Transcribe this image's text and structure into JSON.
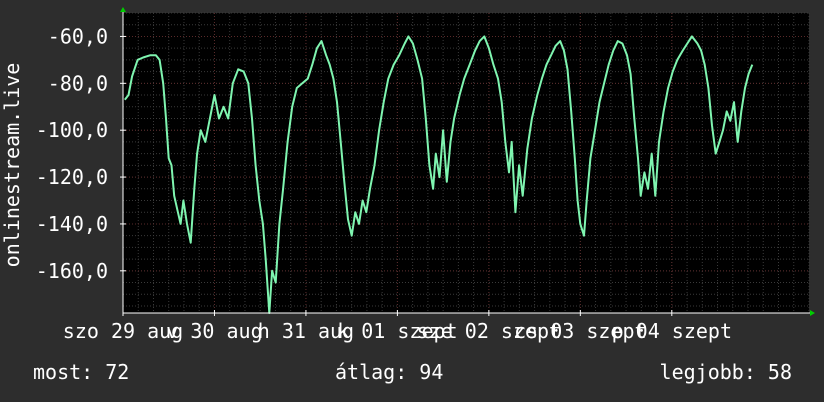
{
  "colors": {
    "background": "#2d2d2d",
    "plot_background": "#000000",
    "grid_minor": "#3a3a3a",
    "grid_major": "#5a2a2a",
    "line": "#7ff5b0",
    "axis_arrow": "#00cc00"
  },
  "chart_data": {
    "type": "line",
    "ylabel": "onlinestream.live",
    "ylim": [
      -178,
      -50
    ],
    "yticks": [
      -60,
      -80,
      -100,
      -120,
      -140,
      -160
    ],
    "ytick_labels": [
      "-60,0",
      "-80,0",
      "-100,0",
      "-120,0",
      "-140,0",
      "-160,0"
    ],
    "xlim": [
      0,
      7.5
    ],
    "xticks": [
      {
        "x": 0.0,
        "label": "szo 29 aug"
      },
      {
        "x": 1.0,
        "label": "v 30 aug"
      },
      {
        "x": 2.0,
        "label": "h 31 aug"
      },
      {
        "x": 3.0,
        "label": "k 01 szept"
      },
      {
        "x": 4.0,
        "label": "sze 02 szept"
      },
      {
        "x": 5.0,
        "label": "cs 03 szept"
      },
      {
        "x": 6.0,
        "label": "p 04 szept"
      }
    ],
    "grid": true,
    "series": [
      {
        "values": [
          [
            0.02,
            -87
          ],
          [
            0.06,
            -85
          ],
          [
            0.1,
            -77
          ],
          [
            0.16,
            -70
          ],
          [
            0.22,
            -69
          ],
          [
            0.3,
            -68
          ],
          [
            0.36,
            -68
          ],
          [
            0.4,
            -70
          ],
          [
            0.44,
            -80
          ],
          [
            0.47,
            -95
          ],
          [
            0.5,
            -112
          ],
          [
            0.53,
            -115
          ],
          [
            0.56,
            -128
          ],
          [
            0.6,
            -135
          ],
          [
            0.63,
            -140
          ],
          [
            0.66,
            -130
          ],
          [
            0.7,
            -140
          ],
          [
            0.74,
            -148
          ],
          [
            0.78,
            -125
          ],
          [
            0.81,
            -110
          ],
          [
            0.85,
            -100
          ],
          [
            0.9,
            -105
          ],
          [
            0.95,
            -95
          ],
          [
            1.0,
            -85
          ],
          [
            1.05,
            -95
          ],
          [
            1.1,
            -90
          ],
          [
            1.15,
            -95
          ],
          [
            1.2,
            -80
          ],
          [
            1.26,
            -74
          ],
          [
            1.32,
            -75
          ],
          [
            1.37,
            -80
          ],
          [
            1.41,
            -95
          ],
          [
            1.45,
            -115
          ],
          [
            1.49,
            -130
          ],
          [
            1.53,
            -140
          ],
          [
            1.56,
            -155
          ],
          [
            1.6,
            -178
          ],
          [
            1.63,
            -160
          ],
          [
            1.67,
            -165
          ],
          [
            1.71,
            -140
          ],
          [
            1.75,
            -125
          ],
          [
            1.8,
            -105
          ],
          [
            1.85,
            -90
          ],
          [
            1.9,
            -82
          ],
          [
            1.96,
            -80
          ],
          [
            2.02,
            -78
          ],
          [
            2.07,
            -72
          ],
          [
            2.12,
            -65
          ],
          [
            2.17,
            -62
          ],
          [
            2.22,
            -68
          ],
          [
            2.26,
            -72
          ],
          [
            2.3,
            -78
          ],
          [
            2.34,
            -88
          ],
          [
            2.38,
            -105
          ],
          [
            2.42,
            -122
          ],
          [
            2.46,
            -138
          ],
          [
            2.5,
            -145
          ],
          [
            2.54,
            -135
          ],
          [
            2.58,
            -140
          ],
          [
            2.62,
            -130
          ],
          [
            2.66,
            -135
          ],
          [
            2.7,
            -125
          ],
          [
            2.75,
            -115
          ],
          [
            2.8,
            -100
          ],
          [
            2.85,
            -88
          ],
          [
            2.9,
            -78
          ],
          [
            2.96,
            -72
          ],
          [
            3.02,
            -68
          ],
          [
            3.08,
            -63
          ],
          [
            3.12,
            -60
          ],
          [
            3.17,
            -63
          ],
          [
            3.22,
            -70
          ],
          [
            3.27,
            -78
          ],
          [
            3.31,
            -95
          ],
          [
            3.35,
            -115
          ],
          [
            3.39,
            -125
          ],
          [
            3.42,
            -110
          ],
          [
            3.46,
            -120
          ],
          [
            3.5,
            -100
          ],
          [
            3.54,
            -122
          ],
          [
            3.58,
            -105
          ],
          [
            3.62,
            -95
          ],
          [
            3.68,
            -85
          ],
          [
            3.73,
            -78
          ],
          [
            3.79,
            -72
          ],
          [
            3.85,
            -66
          ],
          [
            3.9,
            -62
          ],
          [
            3.95,
            -60
          ],
          [
            4.0,
            -65
          ],
          [
            4.05,
            -72
          ],
          [
            4.1,
            -78
          ],
          [
            4.14,
            -88
          ],
          [
            4.18,
            -105
          ],
          [
            4.22,
            -118
          ],
          [
            4.25,
            -105
          ],
          [
            4.29,
            -135
          ],
          [
            4.33,
            -115
          ],
          [
            4.37,
            -128
          ],
          [
            4.42,
            -108
          ],
          [
            4.47,
            -95
          ],
          [
            4.53,
            -85
          ],
          [
            4.58,
            -78
          ],
          [
            4.63,
            -72
          ],
          [
            4.68,
            -68
          ],
          [
            4.73,
            -64
          ],
          [
            4.78,
            -62
          ],
          [
            4.82,
            -66
          ],
          [
            4.86,
            -74
          ],
          [
            4.9,
            -92
          ],
          [
            4.94,
            -112
          ],
          [
            4.97,
            -130
          ],
          [
            5.0,
            -140
          ],
          [
            5.04,
            -145
          ],
          [
            5.07,
            -130
          ],
          [
            5.11,
            -112
          ],
          [
            5.16,
            -100
          ],
          [
            5.21,
            -88
          ],
          [
            5.26,
            -80
          ],
          [
            5.31,
            -72
          ],
          [
            5.36,
            -66
          ],
          [
            5.41,
            -62
          ],
          [
            5.46,
            -63
          ],
          [
            5.51,
            -68
          ],
          [
            5.55,
            -76
          ],
          [
            5.59,
            -95
          ],
          [
            5.63,
            -112
          ],
          [
            5.66,
            -128
          ],
          [
            5.7,
            -118
          ],
          [
            5.74,
            -125
          ],
          [
            5.78,
            -110
          ],
          [
            5.82,
            -128
          ],
          [
            5.86,
            -105
          ],
          [
            5.91,
            -92
          ],
          [
            5.96,
            -82
          ],
          [
            6.01,
            -75
          ],
          [
            6.06,
            -70
          ],
          [
            6.12,
            -66
          ],
          [
            6.17,
            -63
          ],
          [
            6.22,
            -60
          ],
          [
            6.28,
            -63
          ],
          [
            6.32,
            -66
          ],
          [
            6.36,
            -72
          ],
          [
            6.4,
            -82
          ],
          [
            6.44,
            -98
          ],
          [
            6.48,
            -110
          ],
          [
            6.52,
            -105
          ],
          [
            6.56,
            -100
          ],
          [
            6.6,
            -92
          ],
          [
            6.64,
            -96
          ],
          [
            6.68,
            -88
          ],
          [
            6.72,
            -105
          ],
          [
            6.76,
            -92
          ],
          [
            6.8,
            -82
          ],
          [
            6.84,
            -76
          ],
          [
            6.88,
            -72
          ]
        ]
      }
    ]
  },
  "stats": {
    "now": "most: 72",
    "avg": "átlag: 94",
    "best": "legjobb: 58"
  }
}
